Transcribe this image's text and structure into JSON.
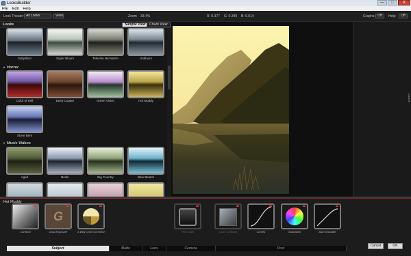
{
  "window": {
    "title": "LooksBuilder",
    "minimize": "—",
    "maximize": "□",
    "close": "X"
  },
  "menu": {
    "file": "File",
    "edit": "Edit",
    "help": "Help"
  },
  "topbar": {
    "look_theater_label": "Look Theater",
    "look_theater_value": "All Looks",
    "view_button": "View",
    "zoom_label": "Zoom",
    "zoom_value": "33.4%",
    "r_readout": "R: 0.377",
    "g_readout": "G: 0.349",
    "b_readout": "B: 0.014",
    "graphs_label": "Graphs:",
    "graphs_value": "Off",
    "help_label": "Help:",
    "help_value": "Off"
  },
  "looks_panel": {
    "title": "Looks",
    "tab_sample": "Sample View",
    "tab_chain": "Chain View",
    "sections": {
      "horror": "Horror",
      "music_videos": "Music Videos"
    },
    "row1": [
      "Saltydhon",
      "Super Bloom",
      "Teleclne Net Warm",
      "Unbloom"
    ],
    "horror_items": [
      "Color of Hell",
      "Deep Copper",
      "Green Vision",
      "Hot Muddy",
      "Stone Bent"
    ],
    "music_items": [
      "Aged",
      "Berlin",
      "Big Country",
      "Blue Bleach"
    ]
  },
  "right_panel": {
    "curves_label": "Curves"
  },
  "bottom": {
    "current_look": "Hot Muddy",
    "tools": [
      "Contrast",
      "Grad Exposure",
      "3-Way Color Corrector",
      "Film Grain",
      "Color Contrast",
      "Curves",
      "Saturation",
      "Auto Shoulder"
    ],
    "grad_letter": "G",
    "tabs": [
      "Subject",
      "Matte",
      "Lens",
      "Camera",
      "Post"
    ],
    "cancel": "Cancel",
    "ok": "OK"
  },
  "colors": {
    "accent_red": "#d33333",
    "panel_bg": "#161616",
    "active_tab": "#e6e6e6"
  }
}
